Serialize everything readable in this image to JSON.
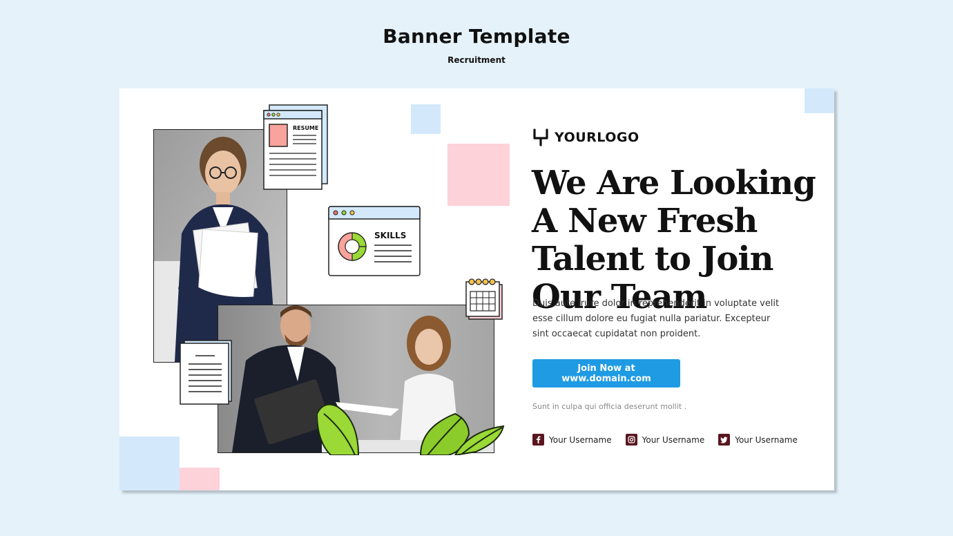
{
  "header": {
    "title": "Banner Template",
    "subtitle": "Recruitment"
  },
  "banner": {
    "logo_text": "YOURLOGO",
    "headline": "We Are Looking A New Fresh Talent to Join Our Team",
    "body": "Duis aute irure dolor in reprehenderit in voluptate velit esse cillum dolore eu fugiat nulla pariatur. Excepteur sint occaecat cupidatat non proident.",
    "cta_label": "Join Now at www.domain.com",
    "fine_print": "Sunt in culpa qui officia deserunt mollit .",
    "illustrations": {
      "resume_label": "RESUME",
      "skills_label": "SKILLS"
    },
    "socials": [
      {
        "icon": "facebook-icon",
        "label": "Your Username"
      },
      {
        "icon": "instagram-icon",
        "label": "Your Username"
      },
      {
        "icon": "twitter-icon",
        "label": "Your Username"
      }
    ]
  },
  "colors": {
    "background": "#e5f2fa",
    "accent_blue": "#1e9be3",
    "square_blue": "#d3e9fb",
    "square_pink": "#fdd2d9",
    "social_icon": "#5a1620"
  }
}
